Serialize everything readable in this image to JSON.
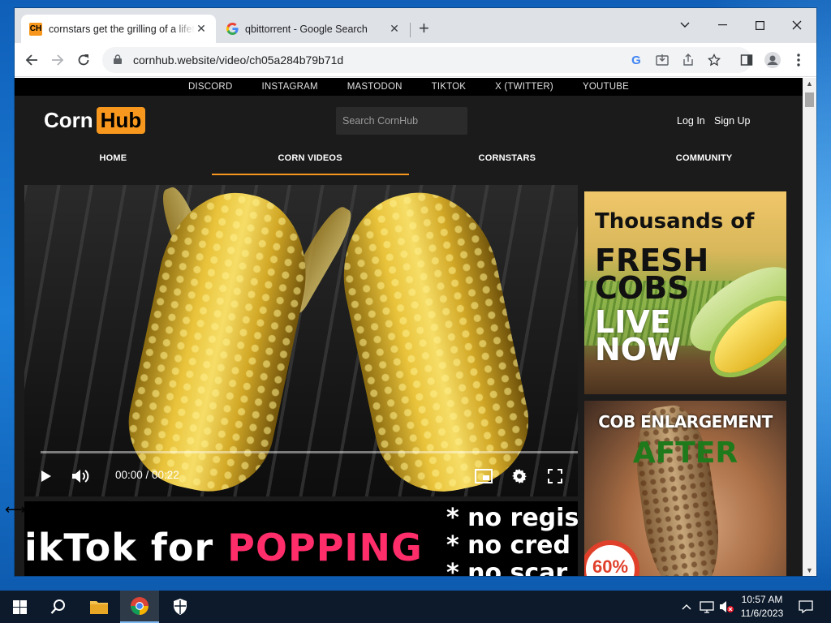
{
  "browser": {
    "tabs": [
      {
        "label": "cornstars get the grilling of a lifetime",
        "favicon": "ch-favicon-icon",
        "active": true
      },
      {
        "label": "qbittorrent - Google Search",
        "favicon": "google-favicon-icon",
        "active": false
      }
    ],
    "url": "cornhub.website/video/ch05a284b79b71d",
    "favicon_letters": "CH",
    "google_letter": "G"
  },
  "site": {
    "social_links": [
      "DISCORD",
      "INSTAGRAM",
      "MASTODON",
      "TIKTOK",
      "X (TWITTER)",
      "YOUTUBE"
    ],
    "logo": {
      "part1": "Corn",
      "part2": "Hub"
    },
    "search_placeholder": "Search CornHub",
    "login": "Log In",
    "signup": "Sign Up",
    "nav": [
      {
        "label": "HOME",
        "active": false
      },
      {
        "label": "CORN VIDEOS",
        "active": true
      },
      {
        "label": "CORNSTARS",
        "active": false
      },
      {
        "label": "COMMUNITY",
        "active": false
      }
    ],
    "accent_color": "#f7971d"
  },
  "video": {
    "time": "00:00 / 00:22",
    "progress": 0.0
  },
  "banner": {
    "prefix": "ikTok",
    "middle": "for",
    "highlight": "POPPING",
    "bullets": [
      "* no regis",
      "* no cred",
      "* no scar"
    ]
  },
  "ads": {
    "ad1": {
      "line1": "Thousands of",
      "line2a": "FRESH",
      "line2b": "COBS",
      "line3a": "LIVE",
      "line3b": "NOW"
    },
    "ad2": {
      "title": "COB ENLARGEMENT",
      "subtitle": "AFTER",
      "badge": "60%"
    }
  },
  "taskbar": {
    "time": "10:57 AM",
    "date": "11/6/2023"
  }
}
